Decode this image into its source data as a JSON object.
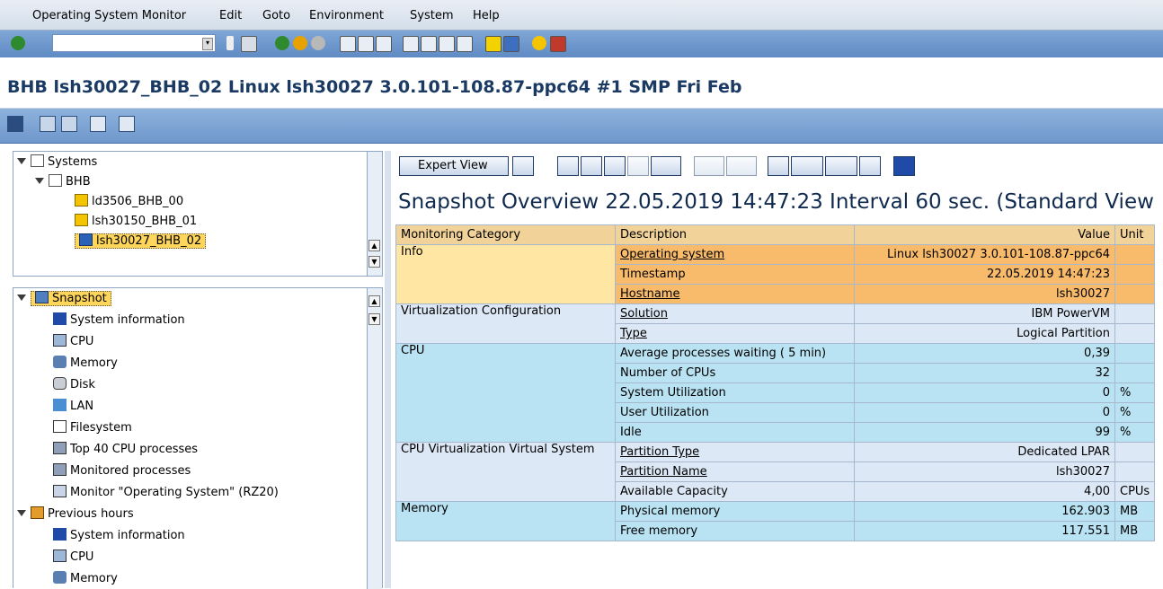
{
  "menu": {
    "items": [
      "Operating System Monitor",
      "Edit",
      "Goto",
      "Environment",
      "System",
      "Help"
    ]
  },
  "command_field": {
    "value": ""
  },
  "title": "BHB lsh30027_BHB_02 Linux lsh30027 3.0.101-108.87-ppc64 #1 SMP Fri Feb",
  "tree": {
    "systems_label": "Systems",
    "group_label": "BHB",
    "servers": [
      "ld3506_BHB_00",
      "lsh30150_BHB_01",
      "lsh30027_BHB_02"
    ],
    "selected_server": "lsh30027_BHB_02"
  },
  "nav": {
    "snapshot_label": "Snapshot",
    "snapshot_items": [
      "System information",
      "CPU",
      "Memory",
      "Disk",
      "LAN",
      "Filesystem",
      "Top 40 CPU processes",
      "Monitored processes",
      "Monitor \"Operating System\" (RZ20)"
    ],
    "previous_label": "Previous hours",
    "previous_items": [
      "System information",
      "CPU",
      "Memory"
    ]
  },
  "alv": {
    "expert_view_label": "Expert View"
  },
  "snapshot_title": "Snapshot Overview 22.05.2019 14:47:23 Interval 60 sec. (Standard View",
  "table": {
    "headers": [
      "Monitoring Category",
      "Description",
      "Value",
      "Unit"
    ],
    "rows": [
      {
        "category": "Info",
        "description": "Operating system",
        "value": "Linux lsh30027 3.0.101-108.87-ppc64",
        "unit": "",
        "link": true
      },
      {
        "category": "",
        "description": "Timestamp",
        "value": "22.05.2019 14:47:23",
        "unit": "",
        "link": false
      },
      {
        "category": "",
        "description": "Hostname",
        "value": "lsh30027",
        "unit": "",
        "link": true
      },
      {
        "category": "Virtualization Configuration",
        "description": "Solution",
        "value": "IBM PowerVM",
        "unit": "",
        "link": true
      },
      {
        "category": "",
        "description": "Type",
        "value": "Logical Partition",
        "unit": "",
        "link": true
      },
      {
        "category": "CPU",
        "description": "Average processes waiting ( 5 min)",
        "value": "0,39",
        "unit": "",
        "link": false
      },
      {
        "category": "",
        "description": "Number of CPUs",
        "value": "32",
        "unit": "",
        "link": false
      },
      {
        "category": "",
        "description": "System Utilization",
        "value": "0",
        "unit": "%",
        "link": false
      },
      {
        "category": "",
        "description": "User Utilization",
        "value": "0",
        "unit": "%",
        "link": false
      },
      {
        "category": "",
        "description": "Idle",
        "value": "99",
        "unit": "%",
        "link": false
      },
      {
        "category": "CPU Virtualization Virtual System",
        "description": "Partition Type",
        "value": "Dedicated LPAR",
        "unit": "",
        "link": true
      },
      {
        "category": "",
        "description": "Partition Name",
        "value": "lsh30027",
        "unit": "",
        "link": true
      },
      {
        "category": "",
        "description": "Available Capacity",
        "value": "4,00",
        "unit": "CPUs",
        "link": false
      },
      {
        "category": "Memory",
        "description": "Physical memory",
        "value": "162.903",
        "unit": "MB",
        "link": false
      },
      {
        "category": "",
        "description": "Free memory",
        "value": "117.551",
        "unit": "MB",
        "link": false
      }
    ]
  },
  "colors": {
    "menu_bg": "#dbe4ef",
    "toolbar_bg": "#6f97cb",
    "info_row": "#f8bb6b",
    "cpu_row": "#b9e2f2",
    "virt_row": "#dce8f5",
    "header_row": "#f1d39a",
    "selection": "#ffd65c"
  }
}
